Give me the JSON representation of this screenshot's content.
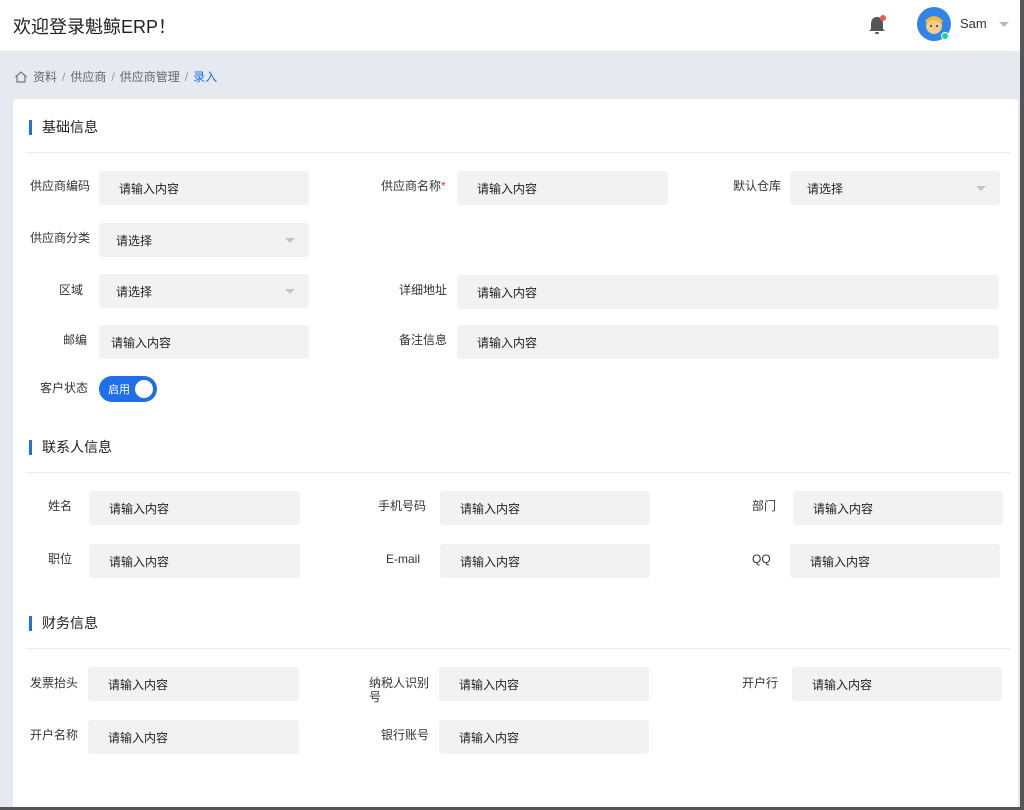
{
  "header": {
    "app_title": "欢迎登录魁鲸ERP！",
    "user_name": "Sam"
  },
  "breadcrumb": {
    "items": [
      "资料",
      "供应商",
      "供应商管理"
    ],
    "current": "录入",
    "separator": "/"
  },
  "sections": {
    "basic": "基础信息",
    "contact": "联系人信息",
    "finance": "财务信息"
  },
  "placeholder": {
    "input": "请输入内容",
    "select": "请选择"
  },
  "basic": {
    "supplier_code": "供应商编码",
    "supplier_name": "供应商名称",
    "required_mark": "*",
    "default_warehouse": "默认仓库",
    "supplier_category": "供应商分类",
    "region": "区域",
    "address": "详细地址",
    "postcode": "邮编",
    "remark": "备注信息",
    "status": "客户状态",
    "status_value": "启用"
  },
  "contact": {
    "name": "姓名",
    "mobile": "手机号码",
    "department": "部门",
    "position": "职位",
    "email": "E-mail",
    "qq": "QQ"
  },
  "finance": {
    "invoice_title": "发票抬头",
    "taxpayer_id": "纳税人识别号",
    "bank": "开户行",
    "account_name": "开户名称",
    "account_no": "银行账号"
  },
  "colors": {
    "accent": "#1f6fea",
    "background": "#e6e9ef",
    "input_bg": "#f2f2f2",
    "required": "#e23a3a"
  }
}
